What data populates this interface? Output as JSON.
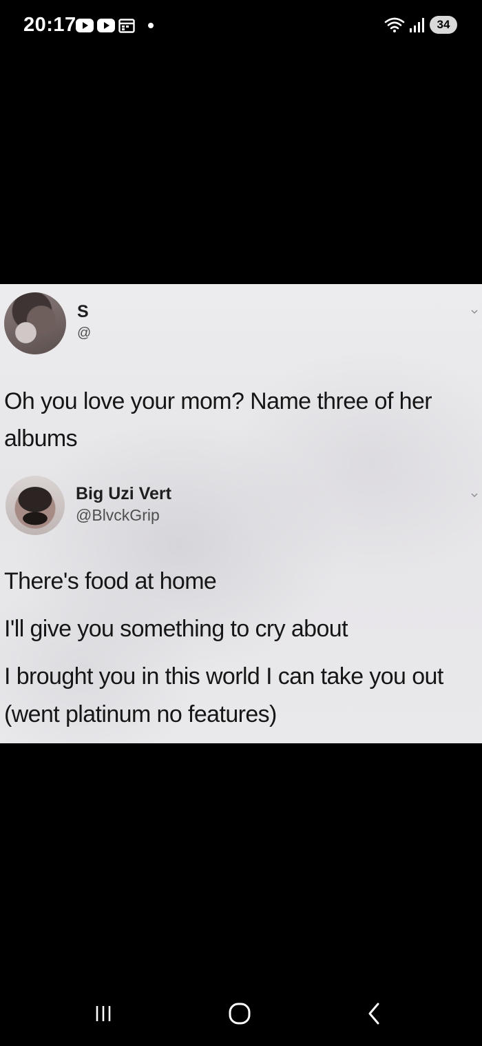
{
  "status_bar": {
    "time": "20:17",
    "notification_icons": [
      "play-icon",
      "play-icon",
      "calendar-icon",
      "dot-icon"
    ],
    "system_icons": [
      "wifi-icon",
      "signal-icon"
    ],
    "battery": "34"
  },
  "meme": {
    "tweet_1": {
      "name": "S",
      "handle": "@",
      "text_lines": [
        "Oh you love your mom? Name three of her",
        "albums"
      ]
    },
    "tweet_2": {
      "name": "Big Uzi Vert",
      "handle": "@BlvckGrip",
      "text_lines": [
        "There's food at home",
        "I'll give you something to cry about",
        "I brought you in this world I can take you out",
        "(went platinum no features)"
      ]
    }
  },
  "nav_bar": {
    "buttons": [
      "recent-apps",
      "home",
      "back"
    ]
  },
  "colors": {
    "background": "#000000",
    "meme_background": "#e9e8eb",
    "text": "#161616"
  }
}
